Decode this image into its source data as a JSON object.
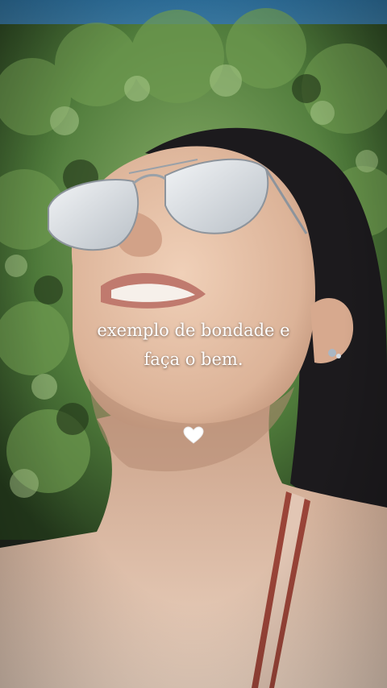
{
  "caption": {
    "line1": "exemplo de bondade e",
    "line2": "faça o bem."
  },
  "decoration": {
    "heart_icon": "white-heart-icon",
    "heart_color": "#ffffff"
  },
  "photo": {
    "subject": "selfie-photo",
    "palette": {
      "sky": "#2e6f96",
      "foliage": "#4f7a3a",
      "skin": "#e6c0a6",
      "hair": "#1c1a1c",
      "glasses": "#d9dde2"
    }
  }
}
